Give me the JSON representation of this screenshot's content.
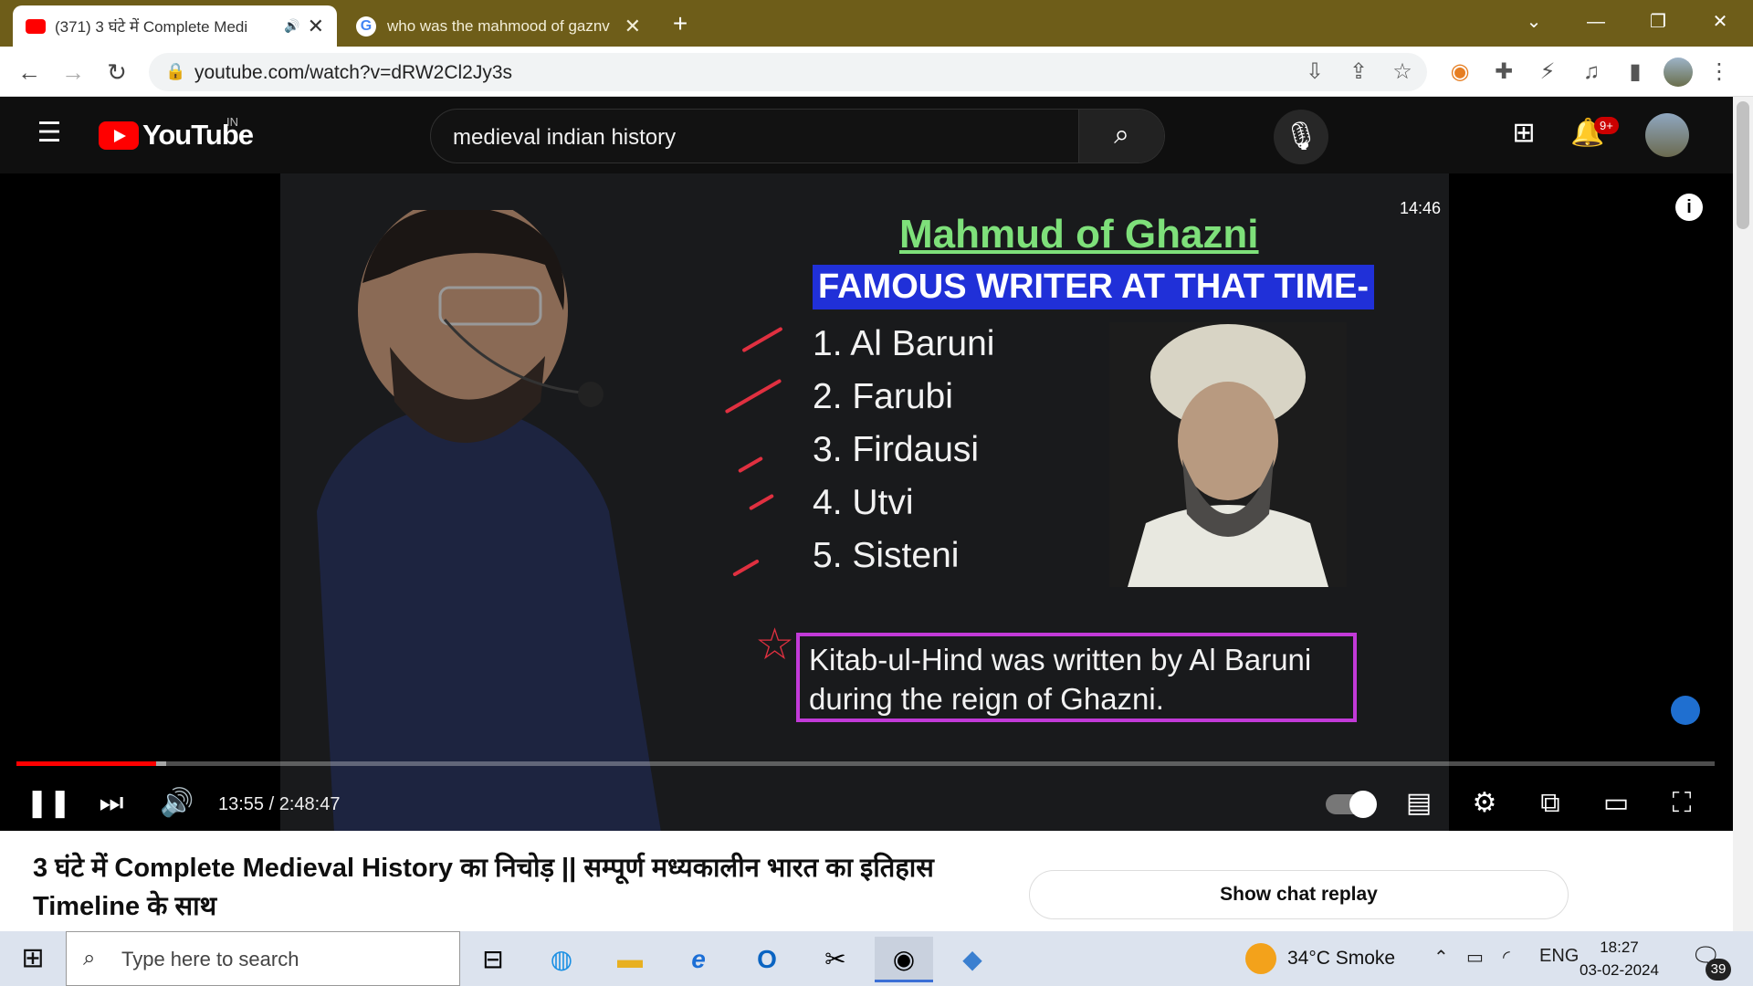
{
  "browser": {
    "tabs": [
      {
        "title": "(371) 3 घंटे में Complete Medi",
        "audio": "🔊",
        "close": "✕"
      },
      {
        "title": "who was the mahmood of gaznv",
        "close": "✕"
      }
    ],
    "new_tab": "+",
    "url": "youtube.com/watch?v=dRW2Cl2Jy3s",
    "window_controls": [
      "⌄",
      "—",
      "❐",
      "✕"
    ]
  },
  "youtube": {
    "logo_text": "YouTube",
    "country": "IN",
    "search_query": "medieval indian history",
    "notif_count": "9+"
  },
  "video": {
    "board": {
      "heading": "Mahmud of Ghazni",
      "subheading": "FAMOUS WRITER AT THAT TIME-",
      "writers": [
        "1.  Al Baruni",
        "2.  Farubi",
        "3.  Firdausi",
        "4.  Utvi",
        "5.  Sisteni"
      ],
      "kitab_line1": "Kitab-ul-Hind was written by Al Baruni",
      "kitab_line2": "during the reign of Ghazni.",
      "timestamp": "14:46"
    },
    "progress": 0.0823,
    "buffered": 0.0882,
    "time": "13:55 / 2:48:47",
    "title": "3 घंटे में Complete Medieval History का निचोड़ || सम्पूर्ण मध्यकालीन भारत का इतिहास Timeline के साथ",
    "chat_replay_label": "Show chat replay"
  },
  "taskbar": {
    "search_placeholder": "Type here to search",
    "weather": "34°C  Smoke",
    "language": "ENG",
    "time": "18:27",
    "date": "03-02-2024",
    "notification_count": "39"
  }
}
